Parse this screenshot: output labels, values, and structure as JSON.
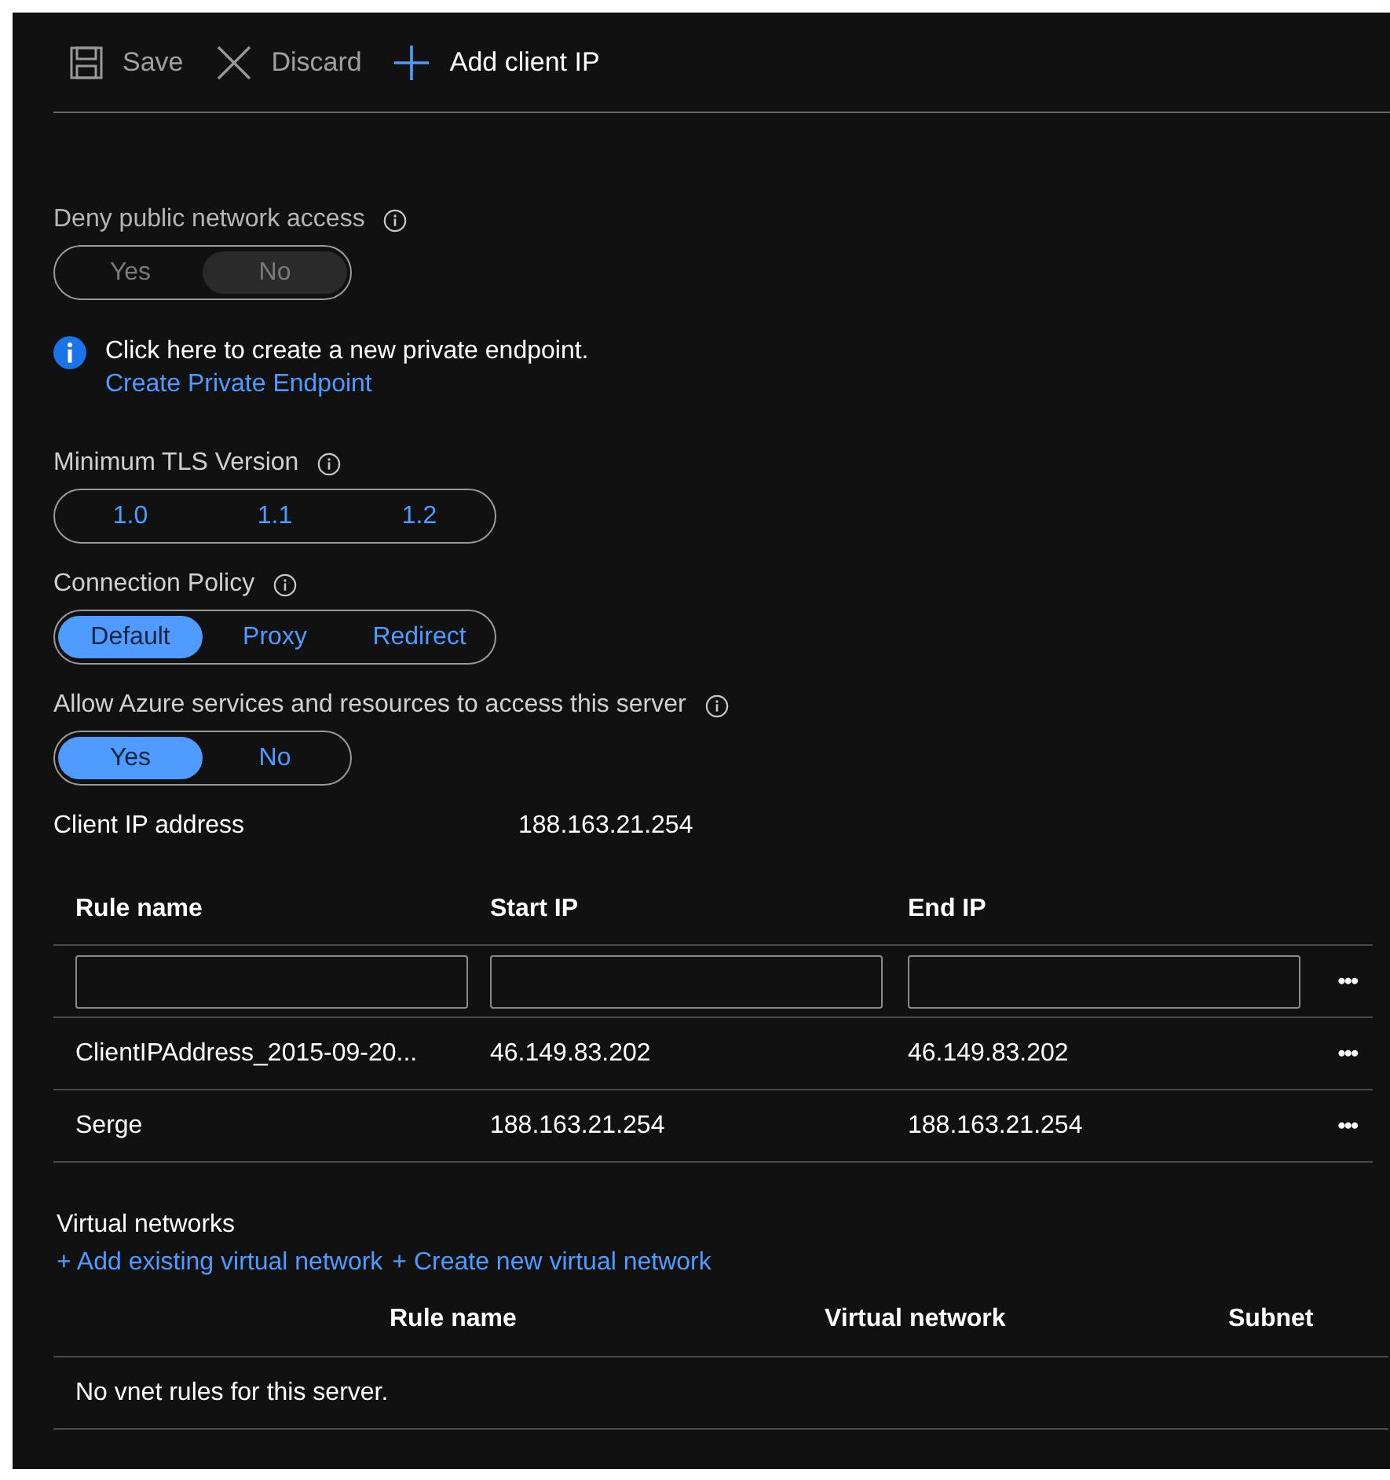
{
  "toolbar": [
    {
      "kind": "save",
      "label": "Save",
      "disabled": true
    },
    {
      "kind": "discard",
      "label": "Discard",
      "disabled": true
    },
    {
      "kind": "add",
      "label": "Add client IP",
      "disabled": false
    }
  ],
  "deny_public": {
    "label": "Deny public network access",
    "disabled": true,
    "options": [
      {
        "label": "Yes",
        "selected": false
      },
      {
        "label": "No",
        "selected": true
      }
    ]
  },
  "info": {
    "message": "Click here to create a new private endpoint.",
    "link": "Create Private Endpoint"
  },
  "tls": {
    "label": "Minimum TLS Version",
    "disabled": false,
    "options": [
      {
        "label": "1.0",
        "selected": false
      },
      {
        "label": "1.1",
        "selected": false
      },
      {
        "label": "1.2",
        "selected": false
      }
    ]
  },
  "connection_policy": {
    "label": "Connection Policy",
    "disabled": false,
    "options": [
      {
        "label": "Default",
        "selected": true
      },
      {
        "label": "Proxy",
        "selected": false
      },
      {
        "label": "Redirect",
        "selected": false
      }
    ]
  },
  "allow_azure": {
    "label": "Allow Azure services and resources to access this server",
    "disabled": false,
    "options": [
      {
        "label": "Yes",
        "selected": true
      },
      {
        "label": "No",
        "selected": false
      }
    ]
  },
  "client_ip": {
    "label": "Client IP address",
    "value": "188.163.21.254"
  },
  "firewall": {
    "columns": [
      "Rule name",
      "Start IP",
      "End IP"
    ],
    "more": "•••",
    "rows": [
      [
        "ClientIPAddress_2015-09-20...",
        "46.149.83.202",
        "46.149.83.202"
      ],
      [
        "Serge",
        "188.163.21.254",
        "188.163.21.254"
      ]
    ]
  },
  "vnet": {
    "title": "Virtual networks",
    "links": [
      "+ Add existing virtual network",
      "+ Create new virtual network"
    ],
    "columns": [
      "Rule name",
      "Virtual network",
      "Subnet"
    ],
    "empty": "No vnet rules for this server."
  }
}
